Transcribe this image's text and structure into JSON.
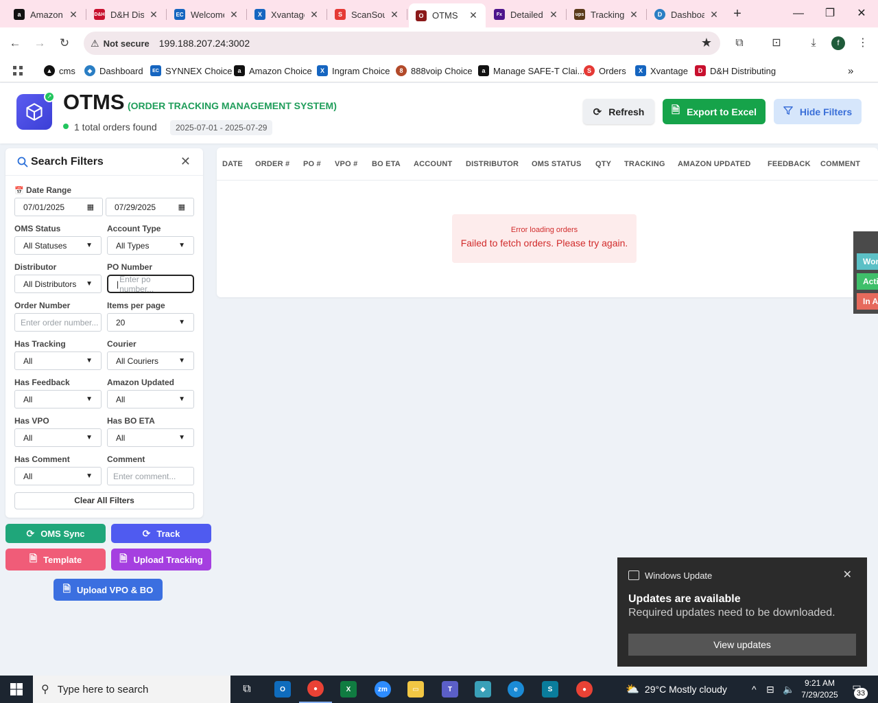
{
  "browser": {
    "tabs": [
      {
        "title": "Amazon",
        "favicon": "amazon-icon",
        "color": "#111111",
        "glyph": "a"
      },
      {
        "title": "D&H Distributing",
        "favicon": "dh-icon",
        "color": "#c8102e",
        "glyph": "D&H"
      },
      {
        "title": "Welcome",
        "favicon": "synnex-icon",
        "color": "#1565c0",
        "glyph": "EC"
      },
      {
        "title": "Xvantage",
        "favicon": "xvantage-icon",
        "color": "#1565c0",
        "glyph": "X"
      },
      {
        "title": "ScanSource",
        "favicon": "scansource-icon",
        "color": "#e53935",
        "glyph": "S"
      },
      {
        "title": "OTMS",
        "favicon": "otms-icon",
        "color": "#8b1a1a",
        "glyph": "O"
      },
      {
        "title": "Detailed",
        "favicon": "fedex-icon",
        "color": "#4d148c",
        "glyph": "Fx"
      },
      {
        "title": "Tracking",
        "favicon": "ups-icon",
        "color": "#5a3a1a",
        "glyph": "ups"
      },
      {
        "title": "Dashboard",
        "favicon": "dashboard-icon",
        "color": "#2a7ec4",
        "glyph": "D"
      }
    ],
    "active_tab_index": 5,
    "address": {
      "security_label": "Not secure",
      "url": "199.188.207.24:3002"
    },
    "profile_initial": "f",
    "bookmarks": [
      {
        "label": "cms",
        "color": "#111111",
        "glyph": "▲"
      },
      {
        "label": "Dashboard",
        "color": "#2a7ec4",
        "glyph": "◆"
      },
      {
        "label": "SYNNEX Choice",
        "color": "#1565c0",
        "glyph": "EC"
      },
      {
        "label": "Amazon Choice",
        "color": "#111111",
        "glyph": "a"
      },
      {
        "label": "Ingram Choice",
        "color": "#1565c0",
        "glyph": "X"
      },
      {
        "label": "888voip Choice",
        "color": "#b24a2a",
        "glyph": "8"
      },
      {
        "label": "Manage SAFE-T Clai...",
        "color": "#111111",
        "glyph": "a"
      },
      {
        "label": "Orders",
        "color": "#e53935",
        "glyph": "S"
      },
      {
        "label": "Xvantage",
        "color": "#1565c0",
        "glyph": "X"
      },
      {
        "label": "D&H Distributing",
        "color": "#c8102e",
        "glyph": "D"
      }
    ]
  },
  "header": {
    "title": "OTMS",
    "subtitle": "(ORDER TRACKING MANAGEMENT SYSTEM)",
    "orders_found": "1 total orders found",
    "date_range": "2025-07-01 - 2025-07-29",
    "buttons": {
      "refresh": "Refresh",
      "export": "Export to Excel",
      "hide_filters": "Hide Filters"
    }
  },
  "filters": {
    "title": "Search Filters",
    "date_range_label": "Date Range",
    "date_from": "07/01/2025",
    "date_to": "07/29/2025",
    "oms_status": {
      "label": "OMS Status",
      "value": "All Statuses"
    },
    "account_type": {
      "label": "Account Type",
      "value": "All Types"
    },
    "distributor": {
      "label": "Distributor",
      "value": "All Distributors"
    },
    "po_number": {
      "label": "PO Number",
      "placeholder": "Enter po number..."
    },
    "order_number": {
      "label": "Order Number",
      "placeholder": "Enter order number..."
    },
    "items_per_page": {
      "label": "Items per page",
      "value": "20"
    },
    "has_tracking": {
      "label": "Has Tracking",
      "value": "All"
    },
    "courier": {
      "label": "Courier",
      "value": "All Couriers"
    },
    "has_feedback": {
      "label": "Has Feedback",
      "value": "All"
    },
    "amazon_updated": {
      "label": "Amazon Updated",
      "value": "All"
    },
    "has_vpo": {
      "label": "Has VPO",
      "value": "All"
    },
    "has_bo_eta": {
      "label": "Has BO ETA",
      "value": "All"
    },
    "has_comment": {
      "label": "Has Comment",
      "value": "All"
    },
    "comment": {
      "label": "Comment",
      "placeholder": "Enter comment..."
    },
    "clear_all": "Clear All Filters"
  },
  "actions": {
    "oms_sync": "OMS Sync",
    "track": "Track",
    "template": "Template",
    "upload_tracking": "Upload Tracking",
    "upload_vpo_bo": "Upload VPO & BO"
  },
  "table": {
    "columns": [
      "DATE",
      "ORDER #",
      "PO #",
      "VPO #",
      "BO ETA",
      "ACCOUNT",
      "DISTRIBUTOR",
      "OMS STATUS",
      "QTY",
      "TRACKING",
      "AMAZON UPDATED",
      "FEEDBACK",
      "COMMENT"
    ],
    "error_title": "Error loading orders",
    "error_message": "Failed to fetch orders. Please try again."
  },
  "side_widget": [
    "Wor",
    "Acti",
    "In A"
  ],
  "toast": {
    "app": "Windows Update",
    "title": "Updates are available",
    "body": "Required updates need to be downloaded.",
    "button": "View updates"
  },
  "taskbar": {
    "search_placeholder": "Type here to search",
    "weather": "29°C  Mostly cloudy",
    "time": "9:21 AM",
    "date": "7/29/2025",
    "notification_count": "33"
  },
  "colors": {
    "accent_green": "#16a34a",
    "teal": "#1fa67a",
    "indigo": "#4f5bf0",
    "purple": "#a53fe0",
    "coral": "#f05c78",
    "blue": "#3b6fe0",
    "error_red": "#d12b2b"
  }
}
